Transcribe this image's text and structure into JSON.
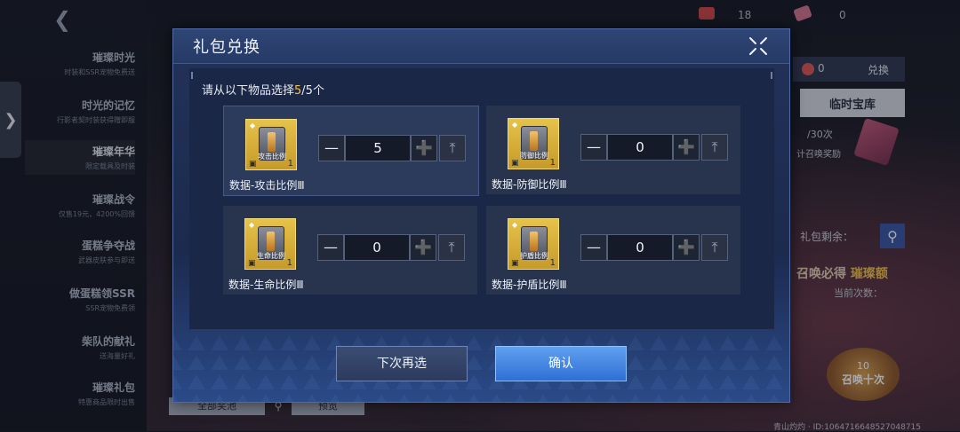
{
  "sidebar": {
    "items": [
      {
        "title": "璀璨时光",
        "subtitle": "时装和SSR宠物免费送"
      },
      {
        "title": "时光的记忆",
        "subtitle": "行影者契时装获得赠即服"
      },
      {
        "title": "璀璨年华",
        "subtitle": "限定载具及时装"
      },
      {
        "title": "璀璨战令",
        "subtitle": "仅售19元，4200%回馈"
      },
      {
        "title": "蛋糕争夺战",
        "subtitle": "武器皮肤参与即送"
      },
      {
        "title": "做蛋糕领SSR",
        "subtitle": "SSR宠物免费领"
      },
      {
        "title": "柴队的献礼",
        "subtitle": "送海量好礼"
      },
      {
        "title": "璀璨礼包",
        "subtitle": "特惠商品限时出售"
      }
    ]
  },
  "topbar": {
    "res1": "18",
    "res2": "0"
  },
  "right_panel": {
    "coin_count": "0",
    "redeem_label": "兑换",
    "temp_store_label": "临时宝库",
    "count_text": "/30次",
    "reward_text": "计召唤奖励",
    "pack_left_label": "礼包剩余：",
    "must_get_prefix": "召唤必得",
    "must_get_highlight": "璀璨额",
    "current_count_label": "当前次数：",
    "ten_draw_count": "10",
    "ten_draw_label": "召唤十次"
  },
  "bottom": {
    "tab1": "全部奖池",
    "tab2": "预览"
  },
  "footer": {
    "id_text": "青山灼灼 · ID:1064716648527048715"
  },
  "dialog": {
    "title": "礼包兑换",
    "prompt_prefix": "请从以下物品选择",
    "prompt_selected": "5",
    "prompt_suffix": "/5个",
    "items": [
      {
        "name": "数据-攻击比例Ⅲ",
        "icon_label": "攻击比例",
        "qty": "1",
        "value": "5",
        "selected": true
      },
      {
        "name": "数据-防御比例Ⅲ",
        "icon_label": "防御比例",
        "qty": "1",
        "value": "0",
        "selected": false
      },
      {
        "name": "数据-生命比例Ⅲ",
        "icon_label": "生命比例",
        "qty": "1",
        "value": "0",
        "selected": false
      },
      {
        "name": "数据-护盾比例Ⅲ",
        "icon_label": "护盾比例",
        "qty": "1",
        "value": "0",
        "selected": false
      }
    ],
    "reset_label": "下次再选",
    "confirm_label": "确认"
  }
}
